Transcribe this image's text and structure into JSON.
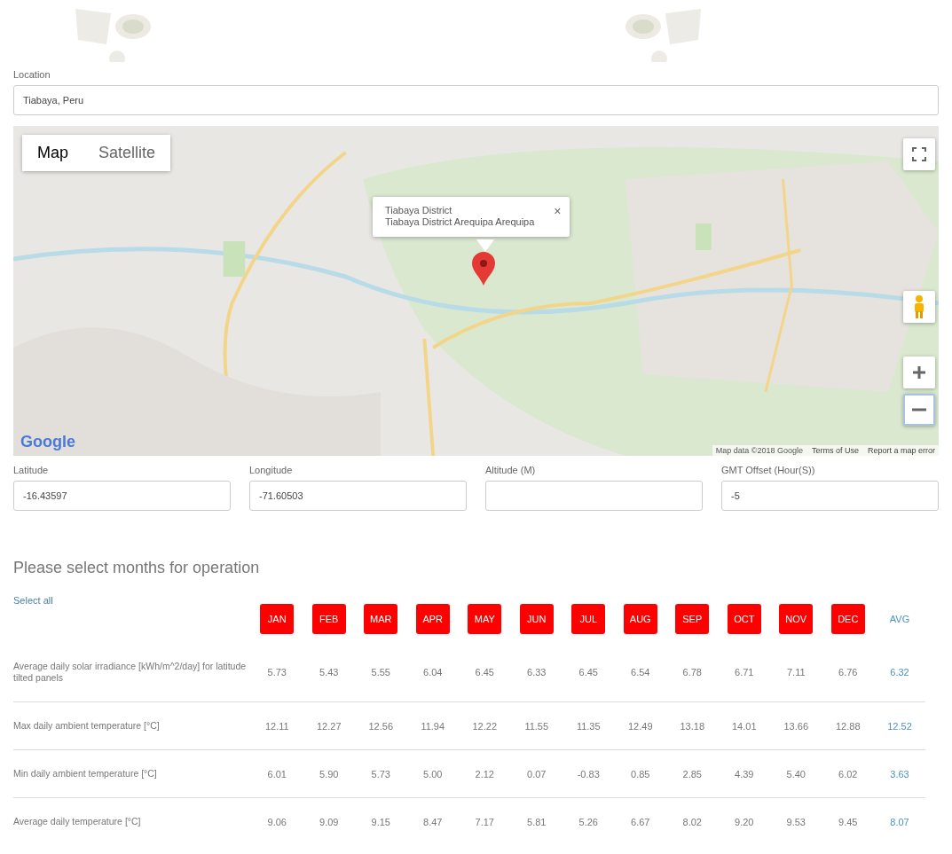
{
  "location": {
    "label": "Location",
    "value": "Tiabaya, Peru"
  },
  "map": {
    "kind": "picture",
    "map_types": [
      {
        "label": "Map",
        "selected": true
      },
      {
        "label": "Satellite",
        "selected": false
      }
    ],
    "info_window": {
      "title": "Tiabaya District",
      "address": "Tiabaya District Arequipa Arequipa",
      "close": "×"
    },
    "logo": "Google",
    "footer": [
      {
        "text": "Map data ©2018 Google",
        "kind": "text"
      },
      {
        "text": "Terms of Use",
        "kind": "link"
      },
      {
        "text": "Report a map error",
        "kind": "link"
      }
    ]
  },
  "coordinates": [
    {
      "label": "Latitude",
      "value": "-16.43597"
    },
    {
      "label": "Longitude",
      "value": "-71.60503"
    },
    {
      "label": "Altitude (M)"
    },
    {
      "label": "GMT Offset (Hour(S))",
      "value": "-5"
    }
  ],
  "months_heading": "Please select months for operation",
  "select_all": "Select all",
  "months": [
    {
      "label": "JAN",
      "selected": true
    },
    {
      "label": "FEB",
      "selected": true
    },
    {
      "label": "MAR",
      "selected": true
    },
    {
      "label": "APR",
      "selected": true
    },
    {
      "label": "MAY",
      "selected": true
    },
    {
      "label": "JUN",
      "selected": true
    },
    {
      "label": "JUL",
      "selected": true
    },
    {
      "label": "AUG",
      "selected": true
    },
    {
      "label": "SEP",
      "selected": true
    },
    {
      "label": "OCT",
      "selected": true
    },
    {
      "label": "NOV",
      "selected": true
    },
    {
      "label": "DEC",
      "selected": true
    }
  ],
  "avg_label": "AVG",
  "rows": [
    {
      "label": "Average daily solar irradiance [kWh/m^2/day] for latitude tilted panels",
      "values": [
        "5.73",
        "5.43",
        "5.55",
        "6.04",
        "6.45",
        "6.33",
        "6.45",
        "6.54",
        "6.78",
        "6.71",
        "7.11",
        "6.76"
      ],
      "avg": "6.32"
    },
    {
      "label": "Max daily ambient temperature [°C]",
      "values": [
        "12.11",
        "12.27",
        "12.56",
        "11.94",
        "12.22",
        "11.55",
        "11.35",
        "12.49",
        "13.18",
        "14.01",
        "13.66",
        "12.88"
      ],
      "avg": "12.52"
    },
    {
      "label": "Min daily ambient temperature [°C]",
      "values": [
        "6.01",
        "5.90",
        "5.73",
        "5.00",
        "2.12",
        "0.07",
        "-0.83",
        "0.85",
        "2.85",
        "4.39",
        "5.40",
        "6.02"
      ],
      "avg": "3.63"
    },
    {
      "label": "Average daily temperature [°C]",
      "values": [
        "9.06",
        "9.09",
        "9.15",
        "8.47",
        "7.17",
        "5.81",
        "5.26",
        "6.67",
        "8.02",
        "9.20",
        "9.53",
        "9.45"
      ],
      "avg": "8.07"
    }
  ]
}
